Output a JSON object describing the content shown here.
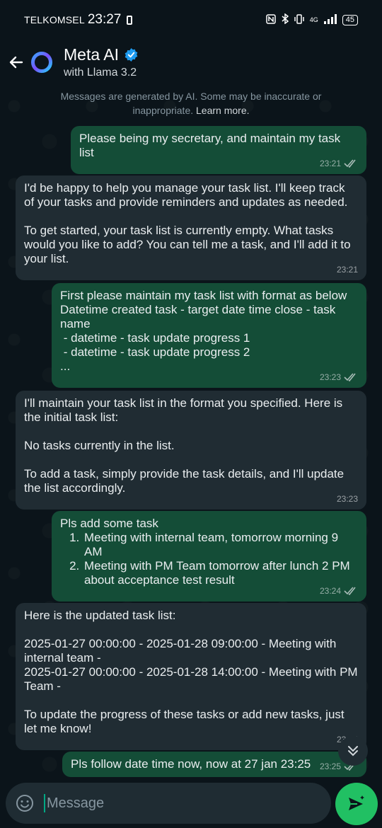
{
  "status": {
    "carrier": "TELKOMSEL",
    "time": "23:27",
    "battery": "45",
    "network": "4G"
  },
  "header": {
    "title": "Meta AI",
    "subtitle": "with Llama 3.2"
  },
  "notice": {
    "text": "Messages are generated by AI. Some may be inaccurate or inappropriate.",
    "link": "Learn more."
  },
  "messages": [
    {
      "from": "user",
      "text": "Please being my secretary, and maintain my task list",
      "time": "23:21",
      "status": "read"
    },
    {
      "from": "ai",
      "text": "I'd be happy to help you manage your task list. I'll keep track of your tasks and provide reminders and updates as needed.\n\nTo get started, your task list is currently empty. What tasks would you like to add? You can tell me a task, and I'll add it to your list.",
      "time": "23:21"
    },
    {
      "from": "user",
      "text": "First please maintain my task list with format as below\nDatetime created task - target date time close - task name\n - datetime - task update progress 1\n - datetime - task update progress 2\n...",
      "time": "23:23",
      "status": "read"
    },
    {
      "from": "ai",
      "text": "I'll maintain your task list in the format you specified. Here is the initial task list:\n\nNo tasks currently in the list.\n\nTo add a task, simply provide the task details, and I'll update the list accordingly.",
      "time": "23:23"
    },
    {
      "from": "user",
      "intro": "Pls add some task",
      "items": [
        "Meeting with internal team, tomorrow morning 9 AM",
        "Meeting with PM Team tomorrow after lunch 2 PM about acceptance test result"
      ],
      "time": "23:24",
      "status": "read"
    },
    {
      "from": "ai",
      "text": "Here is the updated task list:\n\n2025-01-27 00:00:00 - 2025-01-28 09:00:00 - Meeting with internal team -\n2025-01-27 00:00:00 - 2025-01-28 14:00:00 - Meeting with PM Team -\n\nTo update the progress of these tasks or add new tasks, just let me know!",
      "time": "23:24"
    },
    {
      "from": "user",
      "text": "Pls follow date time now, now at 27 jan 23:25",
      "time": "23:25",
      "status": "read"
    }
  ],
  "composer": {
    "placeholder": "Message"
  },
  "icons": {
    "back": "arrow-left-icon",
    "logo": "meta-ai-ring-icon",
    "verified": "verified-badge-icon",
    "emoji": "emoji-icon",
    "send": "send-sparkle-icon",
    "scroll": "double-chevron-down-icon"
  },
  "colors": {
    "outgoing": "#144d37",
    "incoming": "#202c33",
    "accent": "#21c063",
    "background": "#0b141a"
  }
}
